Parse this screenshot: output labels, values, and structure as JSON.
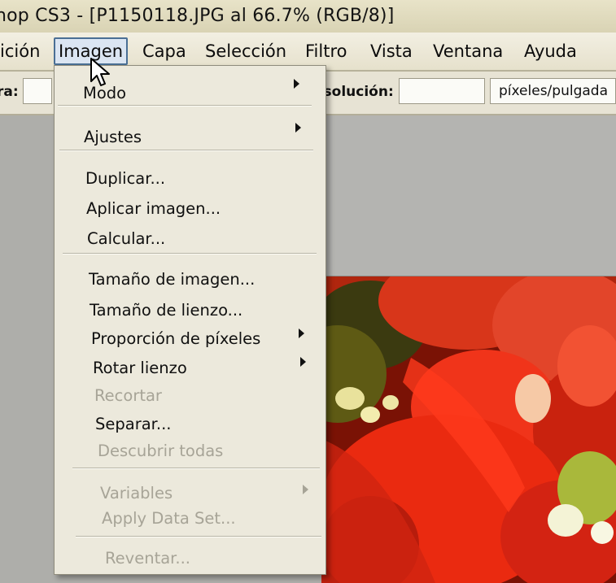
{
  "window": {
    "title": "hop CS3 - [P1150118.JPG al 66.7% (RGB/8)]"
  },
  "menubar": {
    "items": [
      {
        "label": "ición"
      },
      {
        "label": "Imagen",
        "active": true
      },
      {
        "label": "Capa"
      },
      {
        "label": "Selección"
      },
      {
        "label": "Filtro"
      },
      {
        "label": "Vista"
      },
      {
        "label": "Ventana"
      },
      {
        "label": "Ayuda"
      }
    ]
  },
  "options_bar": {
    "left_label": "ra:",
    "resolution_label": "esolución:",
    "resolution_value": "",
    "unit_value": "píxeles/pulgada"
  },
  "image_menu": {
    "items": [
      {
        "label": "Modo",
        "submenu": true,
        "enabled": true
      },
      {
        "label": "Ajustes",
        "submenu": true,
        "enabled": true
      },
      {
        "label": "Duplicar...",
        "submenu": false,
        "enabled": true
      },
      {
        "label": "Aplicar imagen...",
        "submenu": false,
        "enabled": true
      },
      {
        "label": "Calcular...",
        "submenu": false,
        "enabled": true
      },
      {
        "label": "Tamaño de imagen...",
        "submenu": false,
        "enabled": true
      },
      {
        "label": "Tamaño de lienzo...",
        "submenu": false,
        "enabled": true
      },
      {
        "label": "Proporción de píxeles",
        "submenu": true,
        "enabled": true
      },
      {
        "label": "Rotar lienzo",
        "submenu": true,
        "enabled": true
      },
      {
        "label": "Recortar",
        "submenu": false,
        "enabled": false
      },
      {
        "label": "Separar...",
        "submenu": false,
        "enabled": true
      },
      {
        "label": "Descubrir todas",
        "submenu": false,
        "enabled": false
      },
      {
        "label": "Variables",
        "submenu": true,
        "enabled": false
      },
      {
        "label": "Apply Data Set...",
        "submenu": false,
        "enabled": false
      },
      {
        "label": "Reventar...",
        "submenu": false,
        "enabled": false
      }
    ]
  },
  "colors": {
    "menu_background": "#ece9dc",
    "disabled_text": "#a7a497",
    "active_menu_border": "#4a6f95",
    "photo_red": "#e8260f"
  },
  "icons": {
    "cursor": "arrow-cursor-icon",
    "submenu": "submenu-arrow-icon"
  }
}
